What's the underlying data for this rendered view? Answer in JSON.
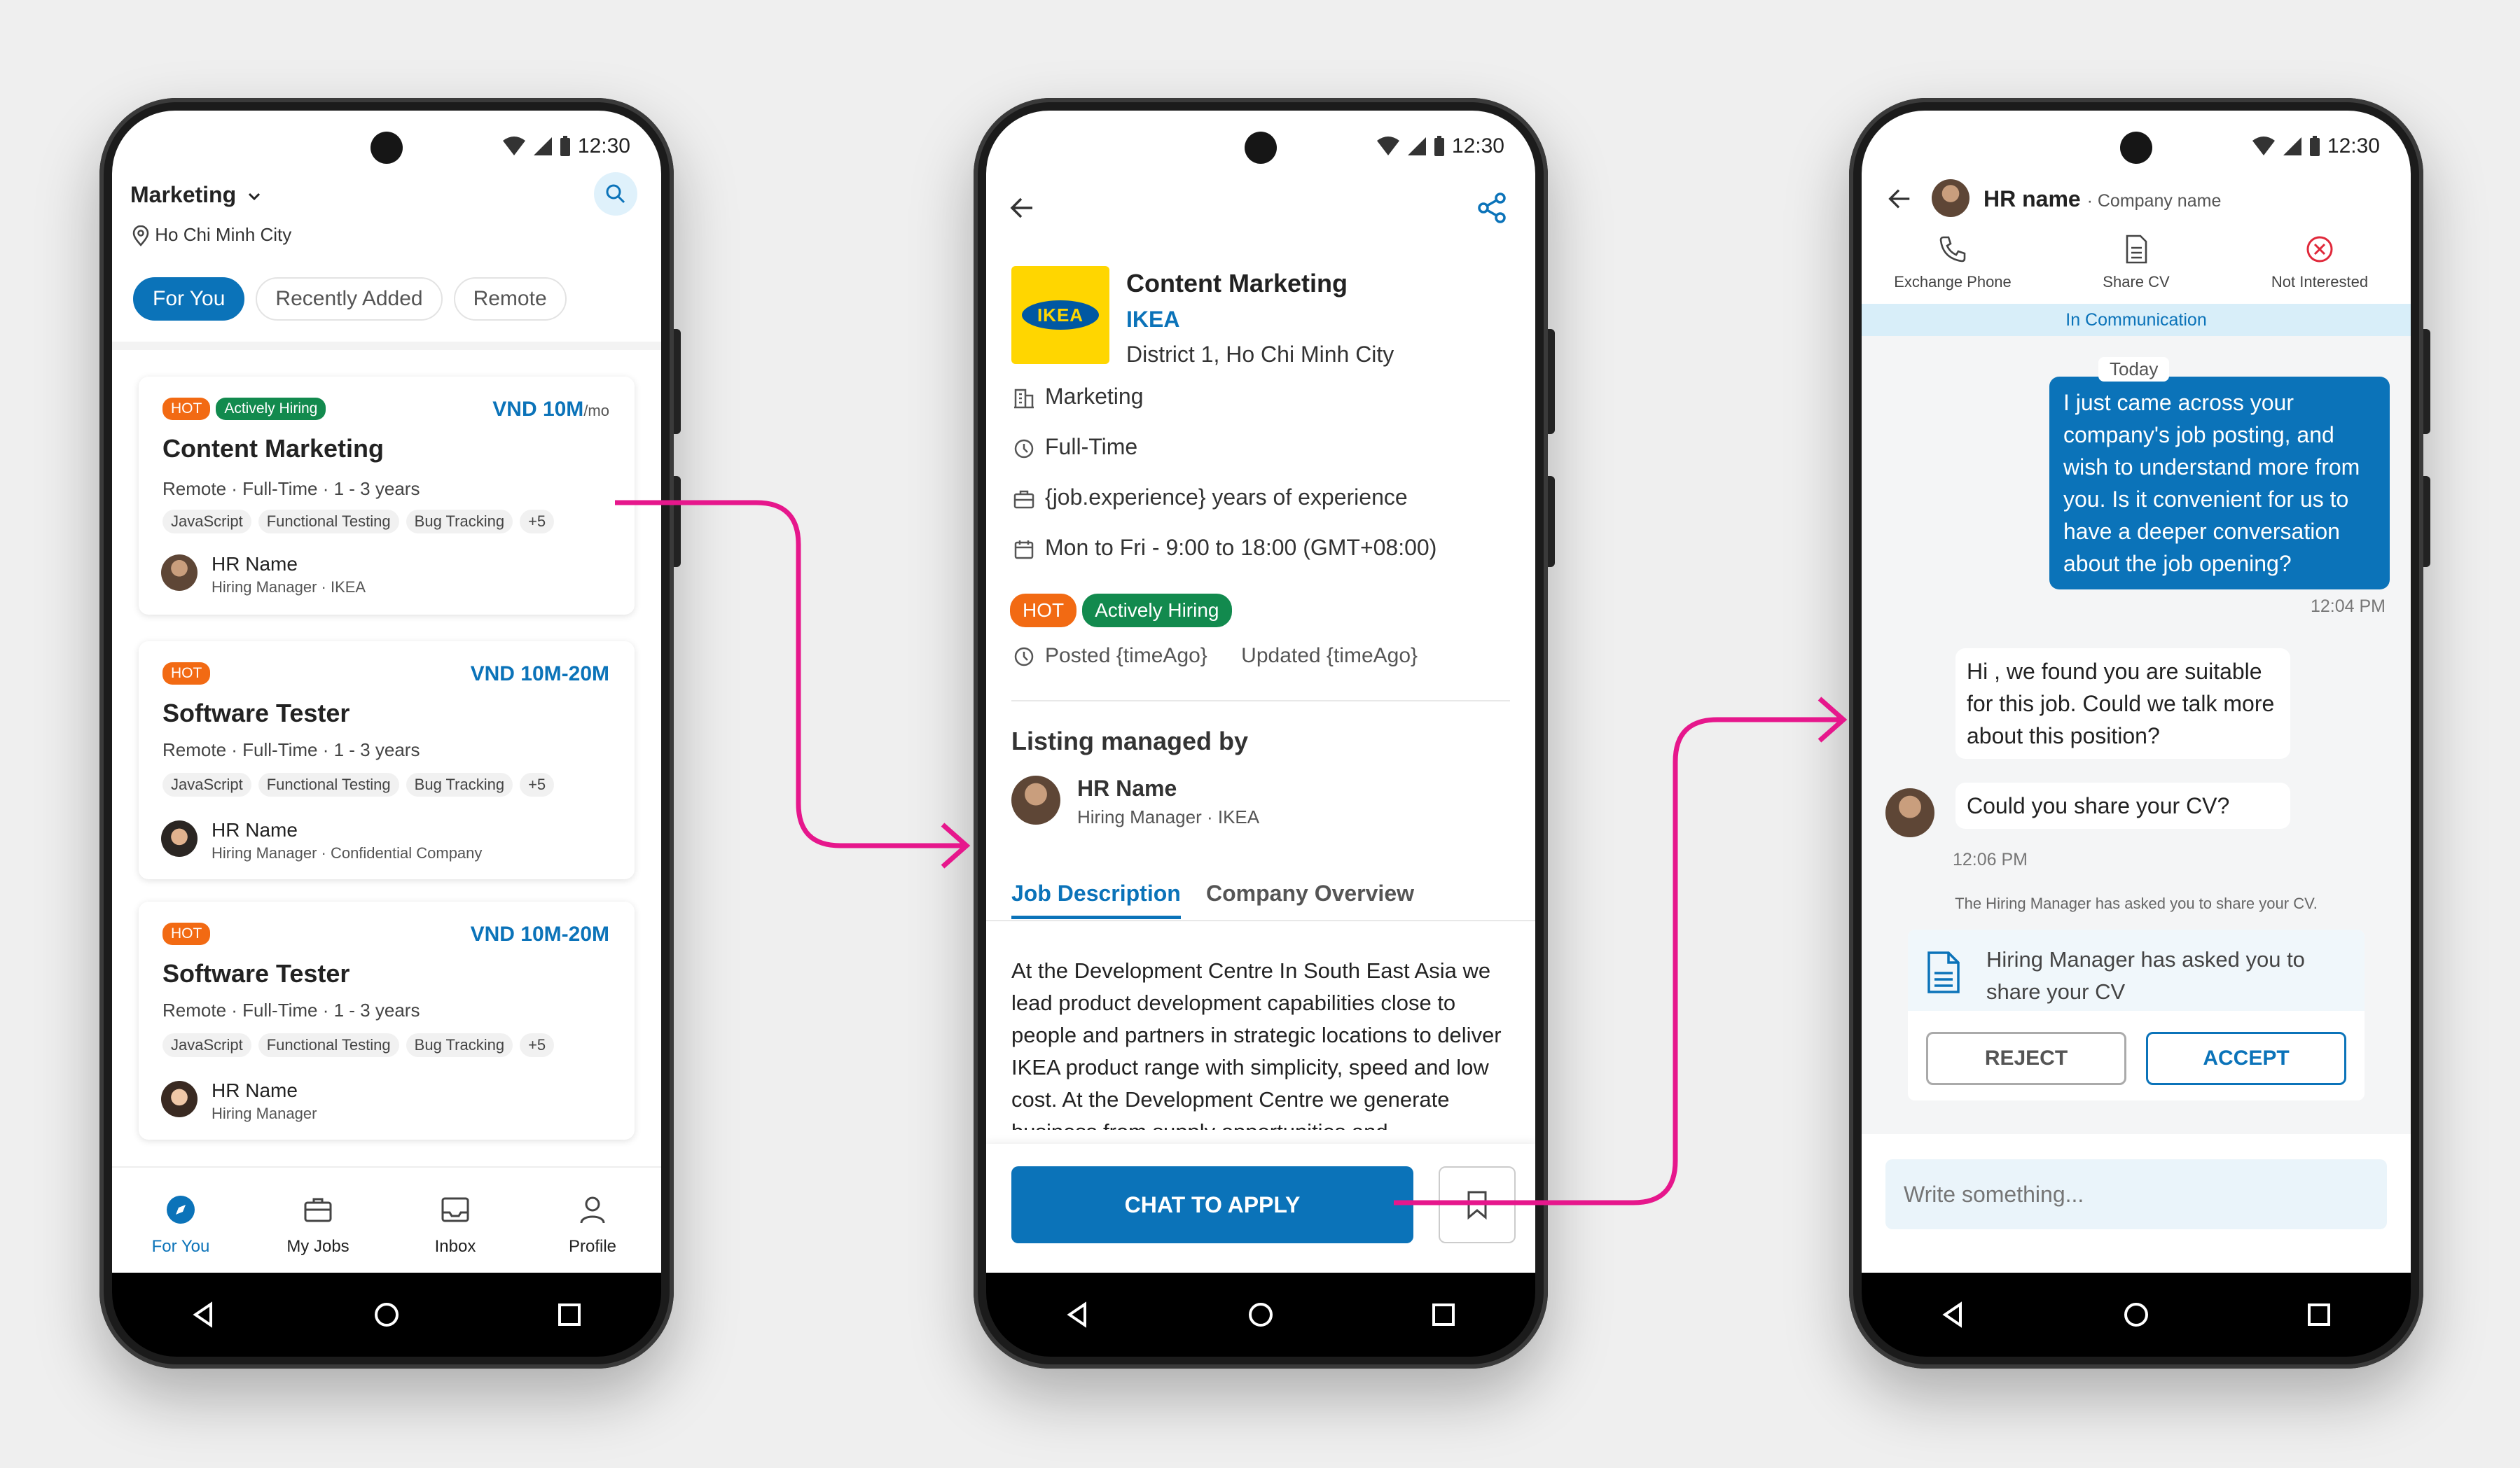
{
  "status": {
    "time": "12:30"
  },
  "colors": {
    "accent": "#0b73b9",
    "hot": "#f26a13",
    "hiring": "#128a4e",
    "arrow": "#e6178c"
  },
  "feed": {
    "category": "Marketing",
    "location": "Ho Chi Minh City",
    "tabs": [
      "For You",
      "Recently Added",
      "Remote"
    ],
    "jobs": [
      {
        "hot": "HOT",
        "hiring": "Actively Hiring",
        "salary": "VND 10M",
        "salary_unit": "/mo",
        "title": "Content Marketing",
        "meta": "Remote · Full-Time · 1 - 3 years",
        "tags": [
          "JavaScript",
          "Functional Testing",
          "Bug Tracking",
          "+5"
        ],
        "hr_name": "HR Name",
        "hr_role": "Hiring Manager · IKEA"
      },
      {
        "hot": "HOT",
        "salary": "VND 10M-20M",
        "title": "Software Tester",
        "meta": "Remote · Full-Time · 1 - 3 years",
        "tags": [
          "JavaScript",
          "Functional Testing",
          "Bug Tracking",
          "+5"
        ],
        "hr_name": "HR Name",
        "hr_role": "Hiring Manager · Confidential Company"
      },
      {
        "hot": "HOT",
        "salary": "VND 10M-20M",
        "title": "Software Tester",
        "meta": "Remote · Full-Time · 1 - 3 years",
        "tags": [
          "JavaScript",
          "Functional Testing",
          "Bug Tracking",
          "+5"
        ],
        "hr_name": "HR Name",
        "hr_role": "Hiring Manager"
      }
    ],
    "nav": [
      "For You",
      "My Jobs",
      "Inbox",
      "Profile"
    ]
  },
  "detail": {
    "title": "Content Marketing",
    "company": "IKEA",
    "logo_text": "IKEA",
    "address": "District 1, Ho Chi Minh City",
    "category": "Marketing",
    "type": "Full-Time",
    "experience": "{job.experience} years of experience",
    "schedule": "Mon to Fri - 9:00 to 18:00 (GMT+08:00)",
    "hot": "HOT",
    "hiring": "Actively Hiring",
    "posted": "Posted {timeAgo}",
    "updated": "Updated {timeAgo}",
    "managed_by": "Listing managed by",
    "hr_name": "HR Name",
    "hr_role": "Hiring Manager · IKEA",
    "tab_desc": "Job Description",
    "tab_company": "Company Overview",
    "description": "At the Development Centre In South East Asia we lead product development capabilities close to people and partners in strategic locations to deliver IKEA product range with simplicity, speed and low cost. At the Development Centre we generate business from supply opportunities and",
    "apply": "CHAT TO APPLY"
  },
  "chat": {
    "hr_name": "HR name",
    "company": "· Company name",
    "actions": [
      "Exchange Phone",
      "Share CV",
      "Not Interested"
    ],
    "status": "In Communication",
    "today": "Today",
    "sent": "I just came across your company's job posting, and wish to understand more from you. Is it convenient for us to have a deeper conversation about the job opening?",
    "sent_time": "12:04 PM",
    "recv1": "Hi , we found you are suitable for this job. Could we talk more about this position?",
    "recv2": "Could you share your CV?",
    "recv_time": "12:06 PM",
    "system": "The Hiring Manager has asked you to share your CV.",
    "request": "Hiring Manager has asked you to share your CV",
    "reject": "REJECT",
    "accept": "ACCEPT",
    "placeholder": "Write something..."
  }
}
